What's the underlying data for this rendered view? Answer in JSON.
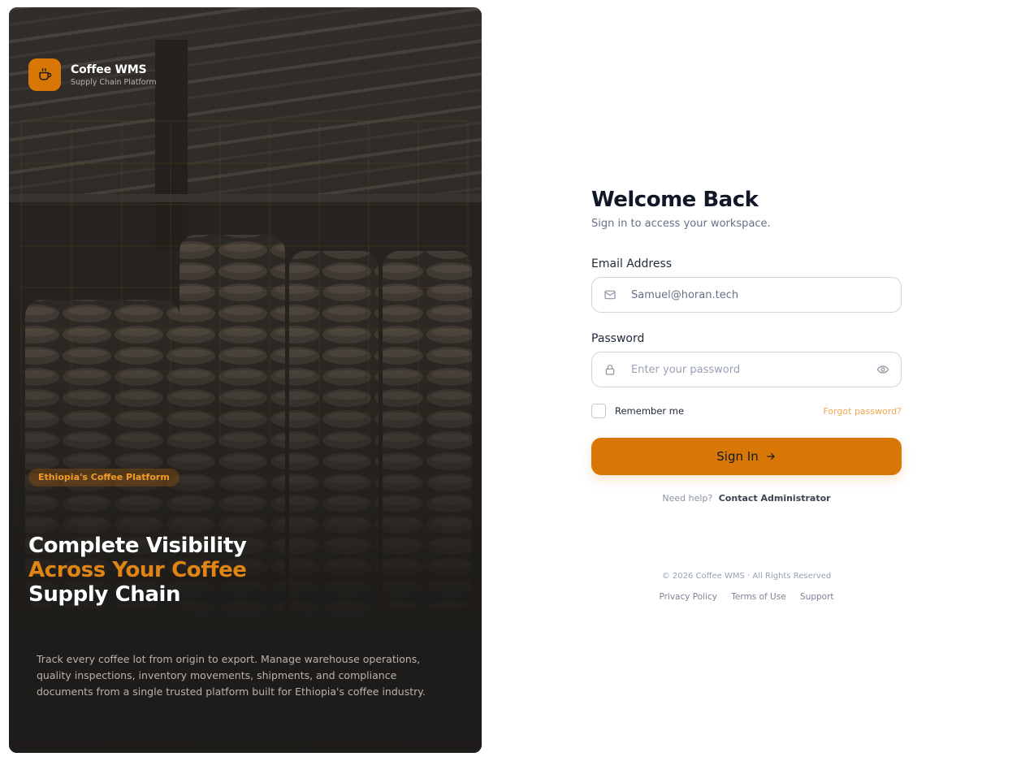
{
  "brand": {
    "name": "Coffee WMS",
    "subtitle": "Supply Chain Platform",
    "accent": "#d97706"
  },
  "hero": {
    "tag": "Ethiopia's Coffee Platform",
    "headline_line1": "Complete Visibility",
    "headline_line2": "Across Your Coffee",
    "headline_line3": "Supply Chain",
    "description": "Track every coffee lot from origin to export. Manage warehouse operations, quality inspections, inventory movements, shipments, and compliance documents from a single trusted platform built for Ethiopia's coffee industry."
  },
  "login": {
    "title": "Welcome Back",
    "subtitle": "Sign in to access your workspace.",
    "email_label": "Email Address",
    "email_value": "Samuel@horan.tech",
    "password_label": "Password",
    "password_placeholder": "Enter your password",
    "remember_label": "Remember me",
    "forgot_label": "Forgot password?",
    "signin_label": "Sign In",
    "help_text": "Need help?",
    "help_link": "Contact Administrator"
  },
  "footer": {
    "copyright": "© 2026 Coffee WMS · All Rights Reserved",
    "links": [
      "Privacy Policy",
      "Terms of Use",
      "Support"
    ]
  },
  "icons": {
    "logo": "coffee-cup-icon",
    "email": "mail-icon",
    "password": "lock-icon",
    "reveal": "eye-icon",
    "signin": "arrow-right-icon"
  }
}
